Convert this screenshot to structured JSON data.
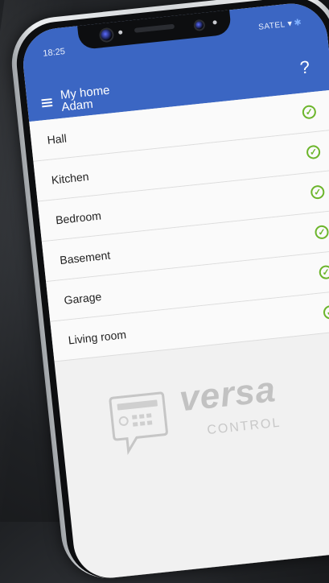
{
  "status_bar": {
    "time": "18:25",
    "carrier": "SATEL"
  },
  "header": {
    "title": "My home",
    "subtitle": "Adam",
    "help_label": "?"
  },
  "zones": [
    {
      "name": "Hall",
      "status": "armed-ok"
    },
    {
      "name": "Kitchen",
      "status": "armed-ok"
    },
    {
      "name": "Bedroom",
      "status": "armed-ok"
    },
    {
      "name": "Basement",
      "status": "armed-ok"
    },
    {
      "name": "Garage",
      "status": "armed-ok"
    },
    {
      "name": "Living room",
      "status": "armed-ok"
    }
  ],
  "brand": {
    "name": "versa",
    "sub": "CONTROL"
  },
  "icons": {
    "menu": "menu-icon",
    "help": "help-icon",
    "check": "check-icon",
    "wifi": "wifi-icon",
    "bluetooth": "bluetooth-icon",
    "keypad": "keypad-icon"
  },
  "colors": {
    "appbar": "#3b66c3",
    "check": "#6cb52b",
    "background": "#f1f1f1"
  }
}
